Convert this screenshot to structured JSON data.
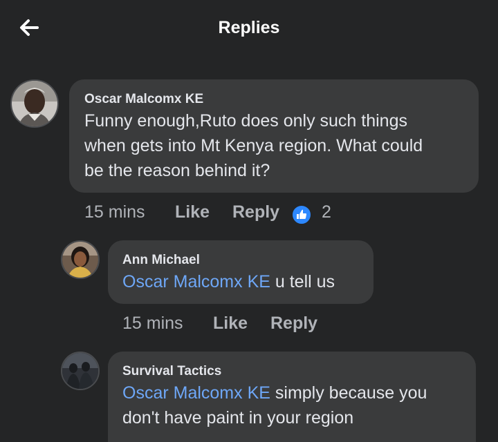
{
  "header": {
    "title": "Replies",
    "back_icon": "arrow-left-icon"
  },
  "colors": {
    "background": "#242526",
    "bubble": "#3a3b3c",
    "mention": "#6ea7f7",
    "like_icon": "#2d88ff",
    "meta": "#b0b3b8"
  },
  "comments": [
    {
      "author": "Oscar Malcomx KE",
      "line1": "Funny enough,Ruto does only such things",
      "line2": "when gets into Mt Kenya region. What could",
      "line3": "be the reason behind it?",
      "time": "15 mins",
      "like_label": "Like",
      "reply_label": "Reply",
      "reaction_icon": "thumbs-up-icon",
      "reaction_count": "2"
    },
    {
      "author": "Ann Michael",
      "mention": "Oscar Malcomx KE",
      "text": " u tell us",
      "time": "15 mins",
      "like_label": "Like",
      "reply_label": "Reply"
    },
    {
      "author": "Survival Tactics",
      "mention": "Oscar Malcomx KE",
      "text1": " simply because you",
      "line2": "don't have paint in your region"
    }
  ]
}
